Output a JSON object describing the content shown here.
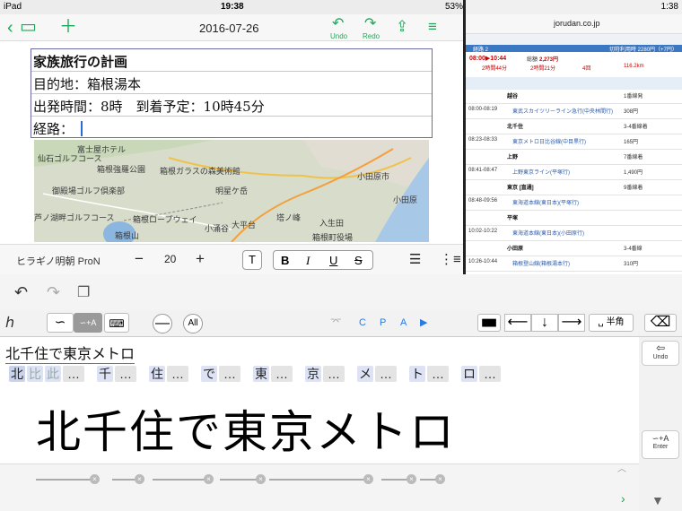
{
  "status_left": {
    "device": "iPad",
    "time": "19:38",
    "battery": "53%"
  },
  "status_right": {
    "time": "1:38"
  },
  "notes": {
    "date": "2016-07-26",
    "undo_label": "Undo",
    "redo_label": "Redo",
    "table_rows": [
      "家族旅行の計画",
      "目的地：箱根湯本",
      "出発時間：8時　到着予定：10時45分",
      "経路："
    ],
    "map_labels": [
      "富士屋ホテル",
      "仙石ゴルフコース",
      "箱根強羅公園",
      "御殿場ゴルフ倶楽部",
      "箱根ガラスの森美術館",
      "芦ノ湖畔ゴルフコース",
      "箱根ロープウェイ",
      "明星ケ岳",
      "小田原市",
      "箱根山",
      "塔ノ峰",
      "入生田",
      "箱根町役場",
      "大平台",
      "小涌谷",
      "小田原"
    ]
  },
  "fontbar": {
    "font_name": "ヒラギノ明朝 ProN",
    "font_size": "20",
    "minus": "−",
    "plus": "+",
    "t_btn": "T",
    "bold": "B",
    "italic": "I",
    "underline": "U",
    "strike": "S"
  },
  "web": {
    "domain": "jorudan.co.jp",
    "route_tab": "経路 2",
    "summary_time": "08:00▶10:44",
    "summary_fare_label": "総額",
    "summary_fare": "2,273円",
    "summary_duration": "2時間44分",
    "summary_ride": "2時間21分",
    "summary_transfer": "4回",
    "summary_distance": "116.2km",
    "fare_ic": "切符利用時 2280円（+7円）",
    "stations": [
      {
        "time": "",
        "name": "越谷",
        "note": "1番線発"
      },
      {
        "time": "08:00-08:19",
        "name": "東武スカイツリーライン急行(中央林間行)",
        "note": "308円"
      },
      {
        "time": "",
        "name": "北千住",
        "note": "3-4番線着"
      },
      {
        "time": "08:23-08:33",
        "name": "東京メトロ日比谷線(中目黒行)",
        "note": "165円"
      },
      {
        "time": "",
        "name": "上野",
        "note": "7番線着"
      },
      {
        "time": "08:41-08:47",
        "name": "上野東京ライン(平塚行)",
        "note": "1,490円"
      },
      {
        "time": "",
        "name": "東京 [直通]",
        "note": "9番線着"
      },
      {
        "time": "08:48-09:56",
        "name": "東海道本線(東日本)(平塚行)",
        "note": ""
      },
      {
        "time": "",
        "name": "平塚",
        "note": ""
      },
      {
        "time": "10:02-10:22",
        "name": "東海道本線(東日本)(小田原行)",
        "note": ""
      },
      {
        "time": "",
        "name": "小田原",
        "note": "3-4番線"
      },
      {
        "time": "10:26-10:44",
        "name": "箱根登山線(箱根湯本行)",
        "note": "310円"
      }
    ]
  },
  "keyboard": {
    "mode_labels": [
      "C",
      "P",
      "A"
    ],
    "all_label": "All",
    "hankaku_label": "半角",
    "input_text": "北千住で東京メトロ",
    "candidates": [
      "北",
      "比",
      "此",
      "…",
      "千",
      "…",
      "住",
      "…",
      "で",
      "…",
      "東",
      "…",
      "京",
      "…",
      "メ",
      "…",
      "ト",
      "…",
      "ロ",
      "…"
    ],
    "handwriting": "北千住で東京メトロ",
    "undo_side": "Undo",
    "enter_side": "Enter"
  }
}
